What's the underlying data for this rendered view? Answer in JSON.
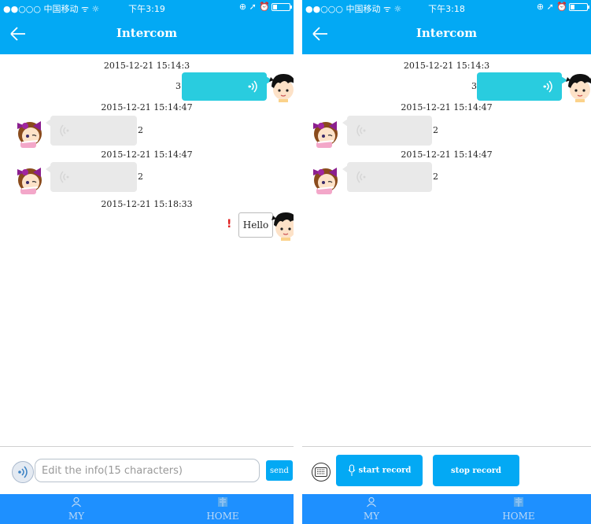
{
  "colors": {
    "accent": "#03a9f4",
    "tabbar": "#1e90ff",
    "sent_bubble": "#29ccdf",
    "received_bubble": "#e9e9e9",
    "error": "#e02020"
  },
  "screens": [
    {
      "status": {
        "carrier": "●●○○○ 中国移动 ᯤ ☼",
        "time": "下午3:19",
        "icons": "⊕ ➚ ⏰"
      },
      "nav": {
        "title": "Intercom",
        "back_icon": "back-arrow-icon"
      },
      "messages": [
        {
          "timestamp": "2015-12-21 15:14:3",
          "side": "sent",
          "kind": "voice",
          "duration": "3"
        },
        {
          "timestamp": "2015-12-21 15:14:47",
          "side": "received",
          "kind": "voice",
          "duration": "2"
        },
        {
          "timestamp": "2015-12-21 15:14:47",
          "side": "received",
          "kind": "voice",
          "duration": "2"
        },
        {
          "timestamp": "2015-12-21 15:18:33",
          "side": "sent",
          "kind": "text",
          "text": "Hello",
          "error_mark": "!"
        }
      ],
      "input": {
        "placeholder": "Edit the info(15 characters)",
        "value": "",
        "send_label": "send"
      },
      "tabs": [
        {
          "label": "MY",
          "icon": "person-icon"
        },
        {
          "label": "HOME",
          "icon": "book-icon"
        }
      ]
    },
    {
      "status": {
        "carrier": "●●○○○ 中国移动 ᯤ ☼",
        "time": "下午3:18",
        "icons": "⊕ ➚ ⏰"
      },
      "nav": {
        "title": "Intercom",
        "back_icon": "back-arrow-icon"
      },
      "messages": [
        {
          "timestamp": "2015-12-21 15:14:3",
          "side": "sent",
          "kind": "voice",
          "duration": "3"
        },
        {
          "timestamp": "2015-12-21 15:14:47",
          "side": "received",
          "kind": "voice",
          "duration": "2"
        },
        {
          "timestamp": "2015-12-21 15:14:47",
          "side": "received",
          "kind": "voice",
          "duration": "2"
        }
      ],
      "record": {
        "start_label": "start record",
        "stop_label": "stop record"
      },
      "tabs": [
        {
          "label": "MY",
          "icon": "person-icon"
        },
        {
          "label": "HOME",
          "icon": "book-icon"
        }
      ]
    }
  ]
}
